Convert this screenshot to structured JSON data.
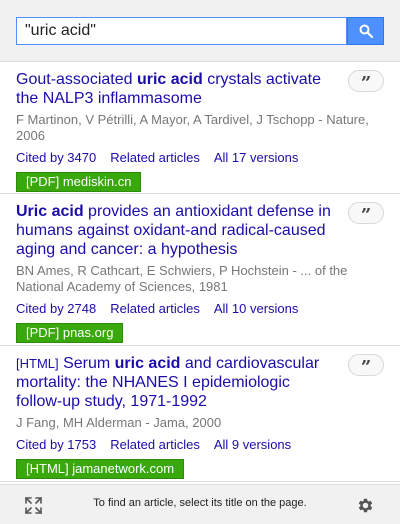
{
  "search": {
    "value": "\"uric acid\"",
    "button_icon": "search-icon"
  },
  "results": [
    {
      "tag": "",
      "title_pre": "Gout-associated ",
      "title_bold": "uric acid",
      "title_post": " crystals activate the NALP3 inflammasome",
      "authors": "F Martinon, V Pétrilli, A Mayor, A Tardivel, J Tschopp - Nature, 2006",
      "cited_by": "Cited by 3470",
      "related": "Related articles",
      "versions": "All 17 versions",
      "source": "[PDF] mediskin.cn"
    },
    {
      "tag": "",
      "title_pre": "",
      "title_bold": "Uric acid",
      "title_post": " provides an antioxidant defense in humans against oxidant-and radical-caused aging and cancer: a hypothesis",
      "authors": "BN Ames, R Cathcart, E Schwiers, P Hochstein - ... of the National Academy of Sciences, 1981",
      "cited_by": "Cited by 2748",
      "related": "Related articles",
      "versions": "All 10 versions",
      "source": "[PDF] pnas.org"
    },
    {
      "tag": "[HTML]",
      "title_pre": " Serum ",
      "title_bold": "uric acid",
      "title_post": " and cardiovascular mortality: the NHANES I epidemiologic follow-up study, 1971-1992",
      "authors": "J Fang, MH Alderman - Jama, 2000",
      "cited_by": "Cited by 1753",
      "related": "Related articles",
      "versions": "All 9 versions",
      "source": "[HTML] jamanetwork.com"
    }
  ],
  "cite_button": {
    "glyph": "”",
    "icon": "quote-icon"
  },
  "footer": {
    "text": "To find an article, select its title on the page.",
    "left_icon": "expand-icon",
    "right_icon": "gear-icon"
  },
  "colors": {
    "link": "#1a0dab",
    "accent": "#4d90fe",
    "source_badge": "#38a80c"
  }
}
